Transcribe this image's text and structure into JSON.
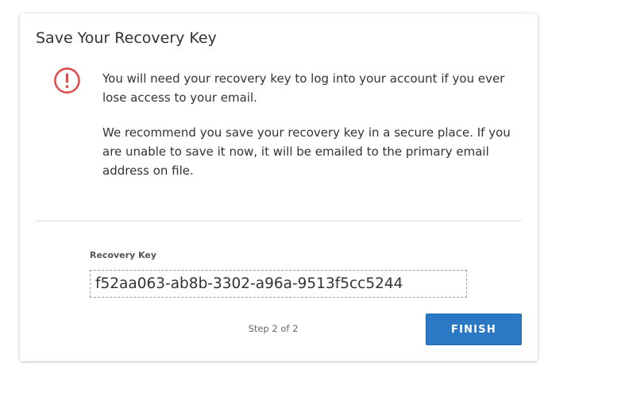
{
  "dialog": {
    "title": "Save Your Recovery Key",
    "icon": "alert-circle-icon",
    "message_primary": "You will need your recovery key to log into your account if you ever lose access to your email.",
    "message_secondary": "We recommend you save your recovery key in a secure place. If you are unable to save it now, it will be emailed to the primary email address on file."
  },
  "recovery_key": {
    "label": "Recovery Key",
    "value": "f52aa063-ab8b-3302-a96a-9513f5cc5244"
  },
  "footer": {
    "step_text": "Step 2 of 2",
    "finish_label": "FINISH"
  },
  "colors": {
    "alert": "#e04b4b",
    "primary_button": "#2b78c5",
    "divider": "#dddddd"
  }
}
